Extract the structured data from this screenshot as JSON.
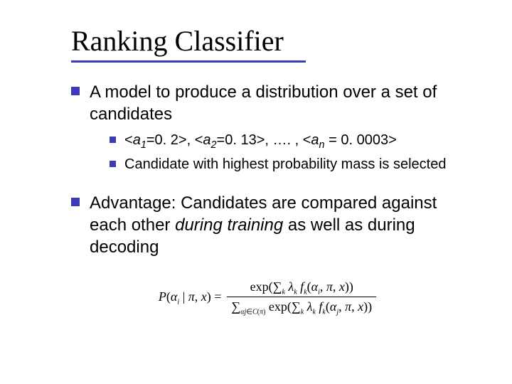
{
  "title": "Ranking Classifier",
  "bullets": [
    {
      "text": "A model to produce a distribution over a set of candidates",
      "sub": [
        {
          "kind": "example"
        },
        {
          "kind": "plain",
          "text": "Candidate with highest probability mass is selected"
        }
      ]
    },
    {
      "kind": "advantage"
    }
  ],
  "example": {
    "prefix_open": "<",
    "var": "a",
    "eq": "=",
    "close": ">",
    "sep": ", ",
    "dots": "…. ,",
    "terms": [
      {
        "idx": "1",
        "val": "0. 2"
      },
      {
        "idx": "2",
        "val": "0. 13"
      }
    ],
    "last": {
      "idx": "n",
      "val": "0. 0003",
      "spaced_eq": " = "
    }
  },
  "advantage": {
    "lead": "Advantage: Candidates are compared against each other ",
    "emph": "during training",
    "tail": " as well as during decoding"
  },
  "formula": {
    "lhs_P": "P",
    "lhs_open": "(",
    "alpha": "α",
    "i": "i",
    "j": "j",
    "bar": " | ",
    "pi": "π",
    "comma": ", ",
    "x": "x",
    "close": ")",
    "eq": " = ",
    "exp": "exp",
    "sum": "∑",
    "k": "k",
    "lambda": "λ",
    "f": "f",
    "in": "∈",
    "C": "C",
    "paren_open": "(",
    "paren_close": ")"
  }
}
